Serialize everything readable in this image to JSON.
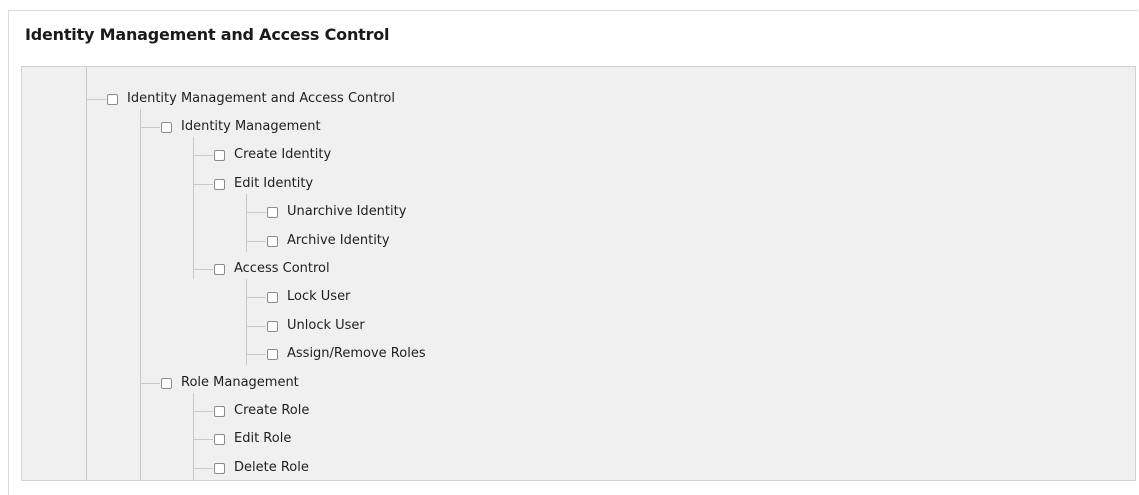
{
  "panel": {
    "title": "Identity Management and Access Control"
  },
  "tree": {
    "nodes": [
      {
        "label": "Identity Management and Access Control",
        "checked": false
      },
      {
        "label": "Identity Management",
        "checked": false
      },
      {
        "label": "Create Identity",
        "checked": false
      },
      {
        "label": "Edit Identity",
        "checked": false
      },
      {
        "label": "Unarchive Identity",
        "checked": false
      },
      {
        "label": "Archive Identity",
        "checked": false
      },
      {
        "label": "Access Control",
        "checked": false
      },
      {
        "label": "Lock User",
        "checked": false
      },
      {
        "label": "Unlock User",
        "checked": false
      },
      {
        "label": "Assign/Remove Roles",
        "checked": false
      },
      {
        "label": "Role Management",
        "checked": false
      },
      {
        "label": "Create Role",
        "checked": false
      },
      {
        "label": "Edit Role",
        "checked": false
      },
      {
        "label": "Delete Role",
        "checked": false
      }
    ]
  },
  "colors": {
    "tree_background": "#f0f0f0",
    "connector_line": "#c9c9c9",
    "checkbox_border": "#8a8a8a"
  }
}
